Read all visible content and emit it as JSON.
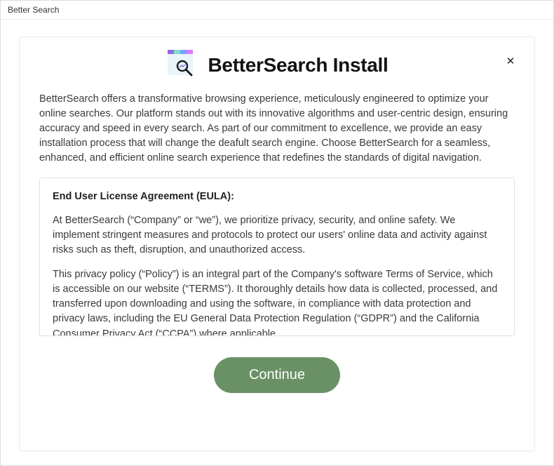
{
  "window": {
    "title": "Better Search"
  },
  "header": {
    "title": "BetterSearch Install",
    "close_label": "✕"
  },
  "intro": "BetterSearch offers a transformative browsing experience, meticulously engineered to optimize your online searches. Our platform stands out with its innovative algorithms and user-centric design, ensuring accuracy and speed in every search. As part of our commitment to excellence, we provide an easy installation process that will change the deafult search engine. Choose BetterSearch for a seamless, enhanced, and efficient online search experience that redefines the standards of digital navigation.",
  "eula": {
    "heading": "End User License Agreement (EULA):",
    "p1": "At BetterSearch (“Company” or “we”), we prioritize privacy, security, and online safety. We implement stringent measures and protocols to protect our users' online data and activity against risks such as theft, disruption, and unauthorized access.",
    "p2": "This privacy policy (“Policy”) is an integral part of the Company's software Terms of Service, which is accessible on our website (“TERMS”). It thoroughly details how data is collected, processed, and transferred upon downloading and using the software, in compliance with data protection and privacy laws, including the EU General Data Protection Regulation (“GDPR”) and the California Consumer Privacy Act (“CCPA”) where applicable."
  },
  "buttons": {
    "continue": "Continue"
  }
}
